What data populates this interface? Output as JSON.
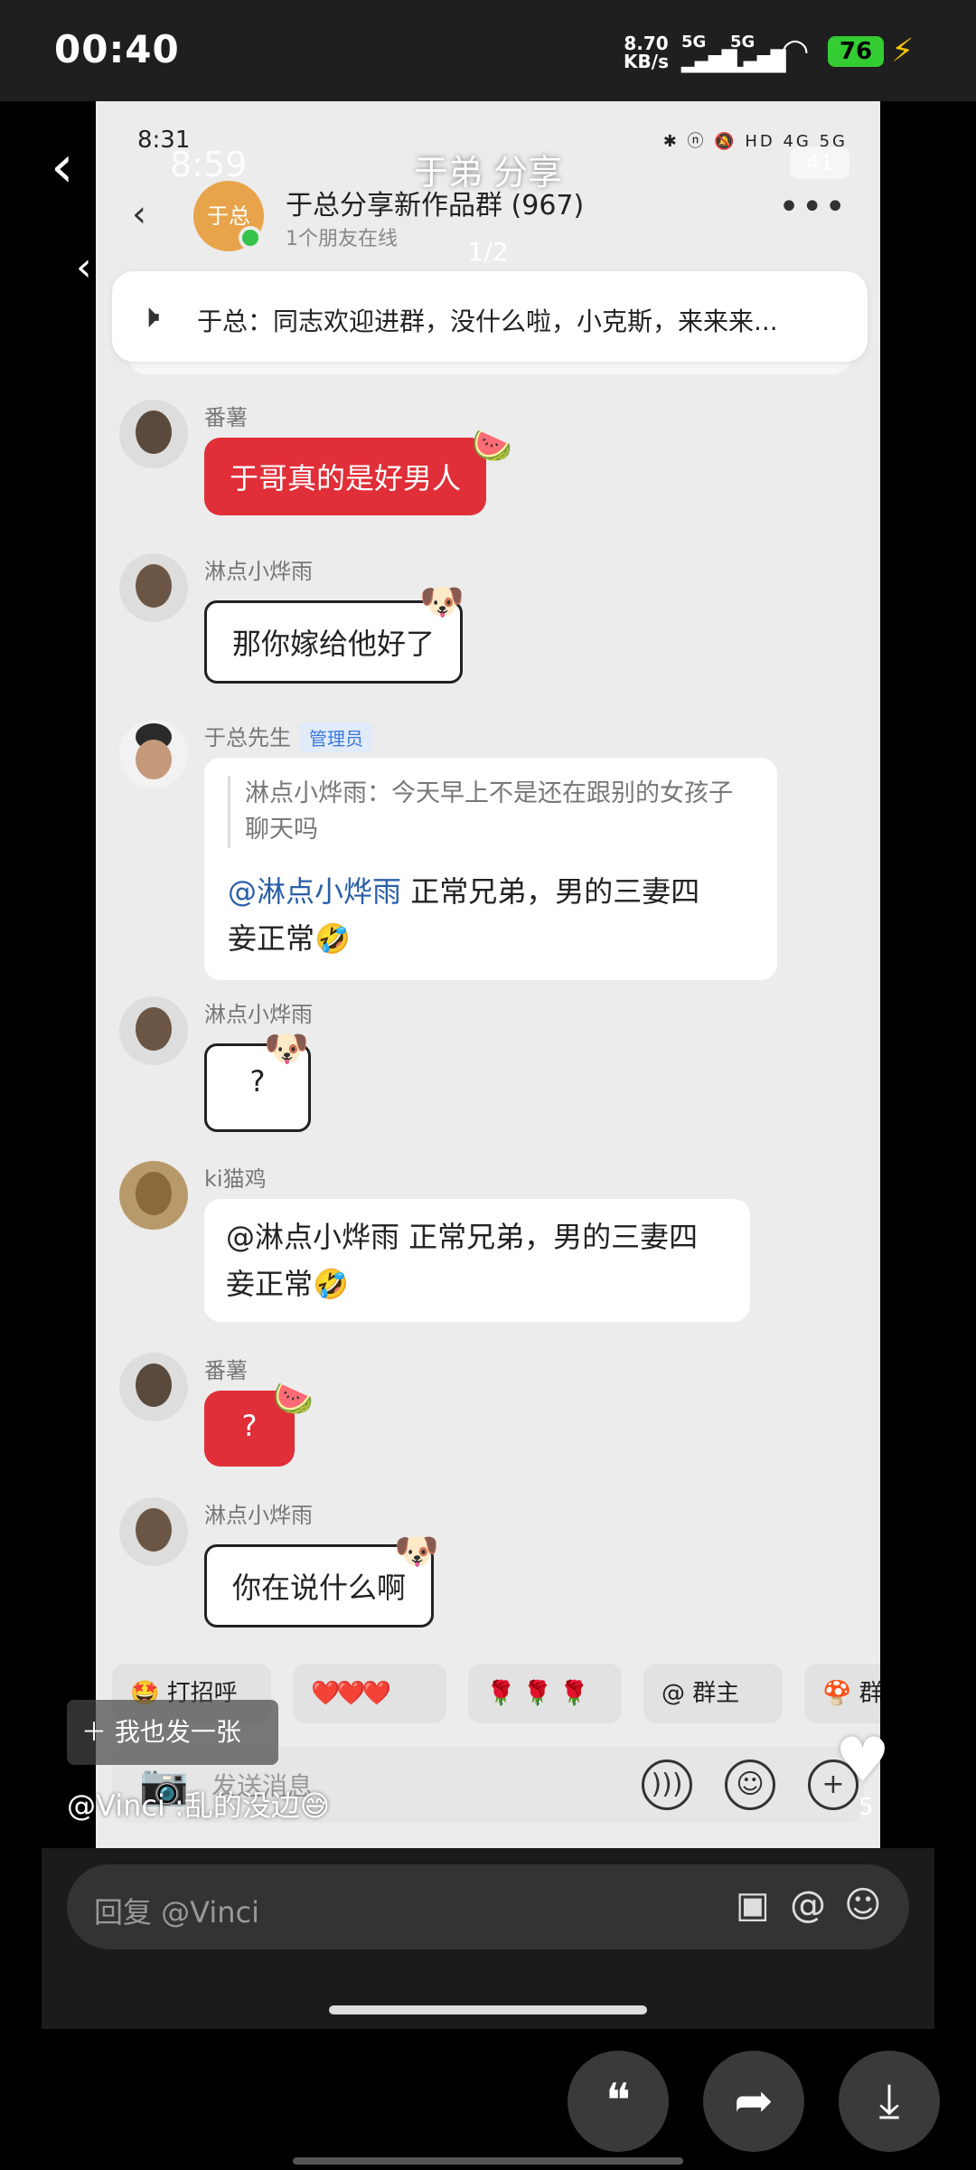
{
  "outer_status": {
    "time": "00:40",
    "speed_value": "8.70",
    "speed_unit": "KB/s",
    "net1": "5G",
    "net2": "5G",
    "battery": "76"
  },
  "inner_status": {
    "time": "8:31",
    "icons": "✱ ⓝ 🔕 HD 4G 5G"
  },
  "header": {
    "group_avatar_text": "于总",
    "group_name": "于总分享新作品群 (967)",
    "online_status": "1个朋友在线"
  },
  "pinned": {
    "text": "于总：同志欢迎进群，没什么啦，小克斯，来来来..."
  },
  "messages": [
    {
      "sender": "番薯",
      "text": "于哥真的是好男人"
    },
    {
      "sender": "淋点小烨雨",
      "text": "那你嫁给他好了"
    },
    {
      "sender": "于总先生",
      "badge": "管理员",
      "quote": "淋点小烨雨：今天早上不是还在跟别的女孩子聊天吗",
      "mention": "@淋点小烨雨",
      "text1": "正常兄弟，男的三妻四",
      "text2": "妾正常🤣"
    },
    {
      "sender": "淋点小烨雨",
      "text": "?"
    },
    {
      "sender": "ki猫鸡",
      "line1": "@淋点小烨雨 正常兄弟，男的三妻四",
      "line2": "妾正常🤣"
    },
    {
      "sender": "番薯",
      "text": "?"
    },
    {
      "sender": "淋点小烨雨",
      "text": "你在说什么啊"
    }
  ],
  "chips": [
    "🤩 打招呼",
    "❤️❤️❤️",
    "🌹 🌹 🌹",
    "@ 群主",
    "🍄 群"
  ],
  "input": {
    "placeholder": "发送消息"
  },
  "overlay": {
    "title": "于弟 分享",
    "fake_time": "8:59",
    "fake_battery": "41",
    "page_indicator": "1/2",
    "post_button": "＋ 我也发一张",
    "caption": "@Vinci :乱的没边😅",
    "like_count": "5"
  },
  "reply": {
    "placeholder": "回复 @Vinci"
  },
  "colors": {
    "accent_red": "#e02f38",
    "mention_blue": "#2a5fa8",
    "badge_blue": "#3b7ad8",
    "online_green": "#35c24a",
    "battery_green": "#33cc33"
  }
}
